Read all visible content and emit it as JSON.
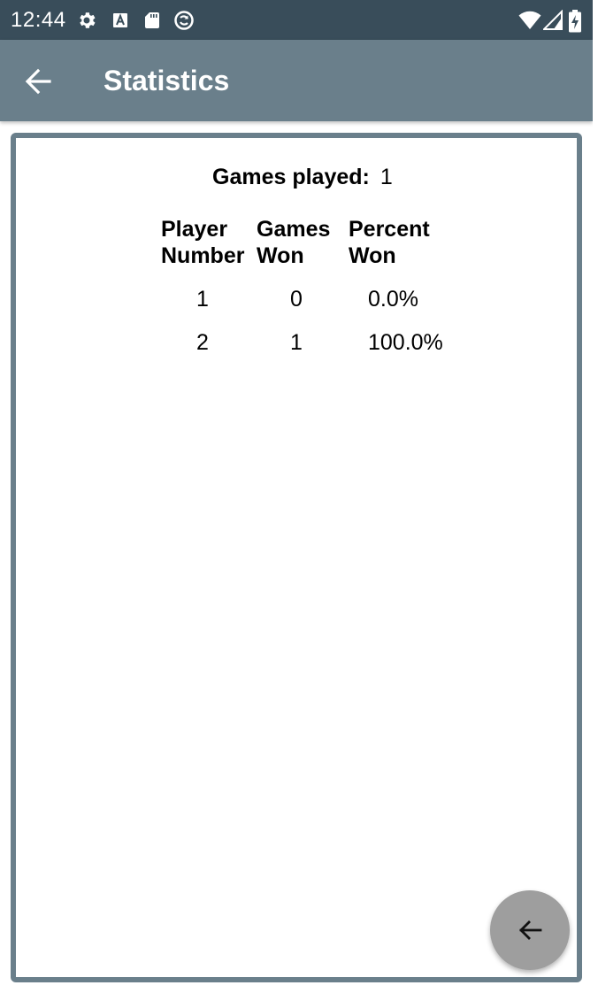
{
  "status_bar": {
    "time": "12:44",
    "left_icons": [
      "gear-icon",
      "font-a-icon",
      "sd-card-icon",
      "sync-circle-icon"
    ],
    "right_icons": [
      "wifi-icon",
      "signal-icon",
      "battery-icon"
    ]
  },
  "app_bar": {
    "title": "Statistics",
    "back_icon": "arrow-back-icon"
  },
  "stats": {
    "games_played_label": "Games played:",
    "games_played_value": "1",
    "headers": {
      "player_line1": "Player",
      "player_line2": "Number",
      "won_line1": "Games",
      "won_line2": "Won",
      "pct_line1": "Percent",
      "pct_line2": "Won"
    },
    "rows": [
      {
        "player": "1",
        "won": "0",
        "percent": "0.0%"
      },
      {
        "player": "2",
        "won": "1",
        "percent": "100.0%"
      }
    ]
  },
  "fab": {
    "icon": "arrow-back-icon"
  },
  "colors": {
    "status_bar": "#394d5a",
    "app_bar": "#6a7f8b",
    "card_border": "#6a7f8b",
    "fab": "#9e9e9e"
  }
}
